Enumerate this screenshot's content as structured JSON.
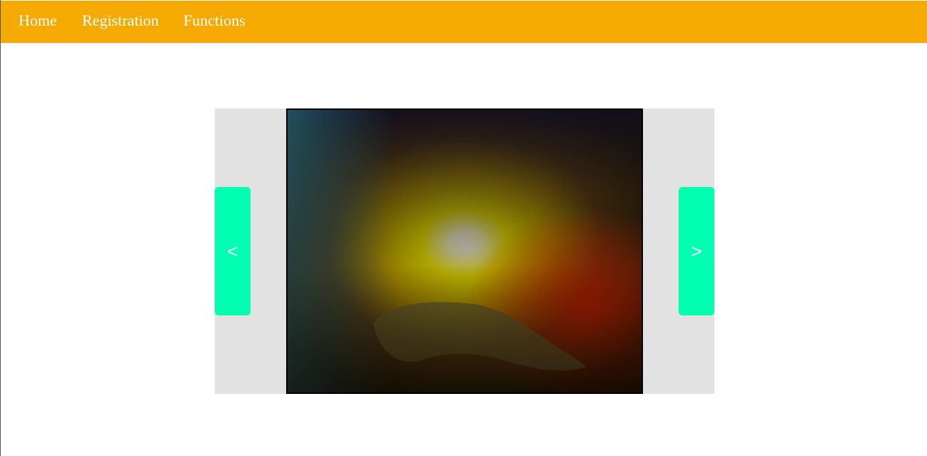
{
  "colors": {
    "navbar_bg": "#f4aa00",
    "nav_text": "#ffffff",
    "slider_bg": "#e2e2e2",
    "arrow_bg": "#00ffb0"
  },
  "nav": {
    "items": [
      {
        "label": "Home"
      },
      {
        "label": "Registration"
      },
      {
        "label": "Functions"
      }
    ]
  },
  "slider": {
    "prev_label": "<",
    "next_label": ">",
    "image": {
      "icon": "landscape-sunset-river-image"
    }
  }
}
